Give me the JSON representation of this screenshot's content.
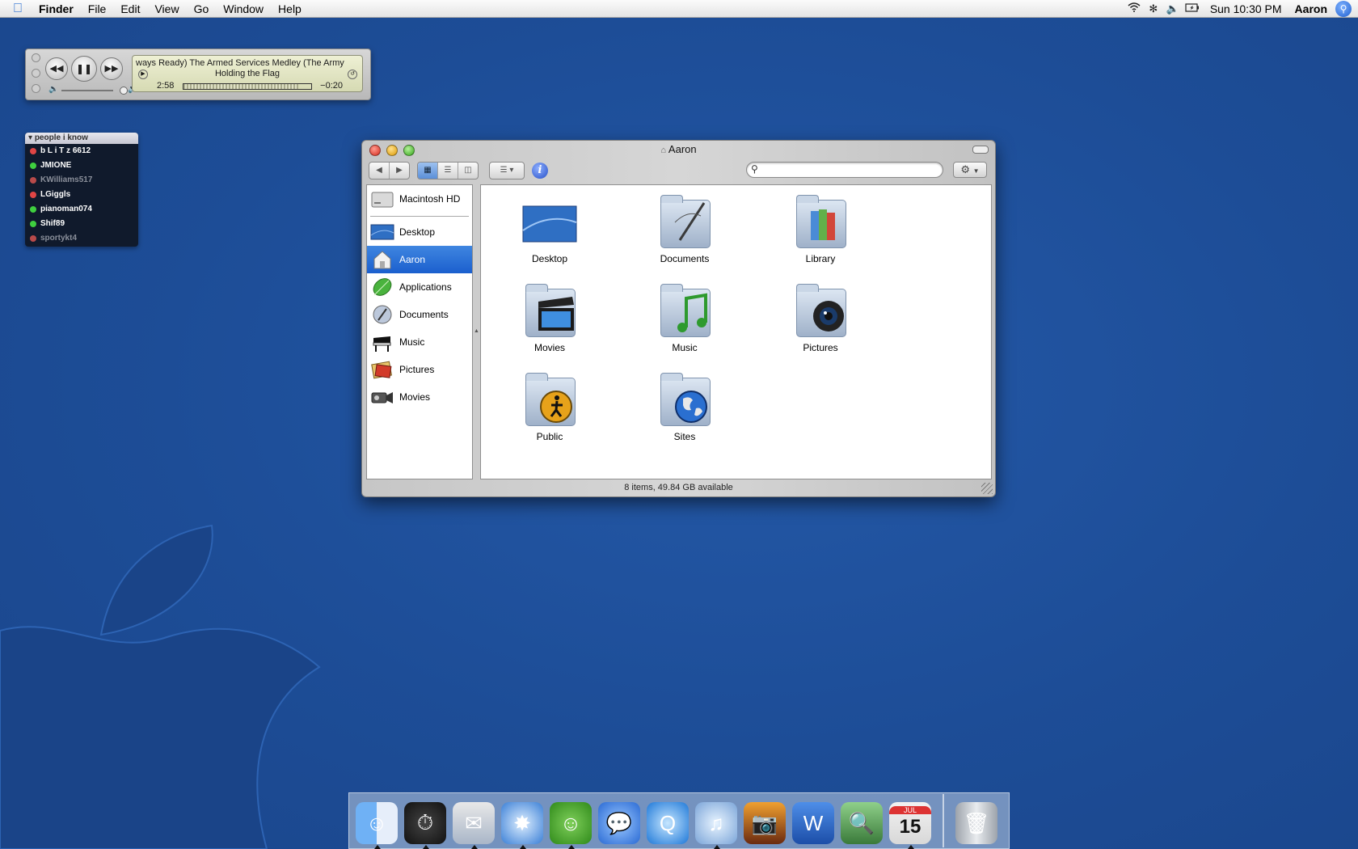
{
  "menubar": {
    "app_name": "Finder",
    "menus": [
      "File",
      "Edit",
      "View",
      "Go",
      "Window",
      "Help"
    ],
    "clock": "Sun 10:30 PM",
    "user": "Aaron"
  },
  "itunes": {
    "scroll_text": "ways Ready)    The Armed Services Medley (The Army",
    "line2": "Holding the Flag",
    "elapsed": "2:58",
    "remaining": "−0:20",
    "progress": 0.9
  },
  "buddy_list": {
    "group": "people i know",
    "buddies": [
      {
        "name": "b L i T z 6612",
        "status": "away"
      },
      {
        "name": "JMIONE",
        "status": "online"
      },
      {
        "name": "KWilliams517",
        "status": "idle"
      },
      {
        "name": "LGiggls",
        "status": "away"
      },
      {
        "name": "pianoman074",
        "status": "online"
      },
      {
        "name": "Shif89",
        "status": "online"
      },
      {
        "name": "sportykt4",
        "status": "idle"
      }
    ]
  },
  "finder": {
    "title": "Aaron",
    "search": {
      "value": "",
      "placeholder": ""
    },
    "sidebar": {
      "devices": [
        {
          "label": "Macintosh HD",
          "icon": "hard-drive-icon"
        }
      ],
      "places": [
        {
          "label": "Desktop",
          "icon": "desktop-icon",
          "selected": false
        },
        {
          "label": "Aaron",
          "icon": "home-icon",
          "selected": true
        },
        {
          "label": "Applications",
          "icon": "applications-icon",
          "selected": false
        },
        {
          "label": "Documents",
          "icon": "documents-icon",
          "selected": false
        },
        {
          "label": "Music",
          "icon": "piano-icon",
          "selected": false
        },
        {
          "label": "Pictures",
          "icon": "pictures-icon",
          "selected": false
        },
        {
          "label": "Movies",
          "icon": "camcorder-icon",
          "selected": false
        }
      ]
    },
    "items": [
      {
        "label": "Desktop",
        "icon": "desktop-folder-icon"
      },
      {
        "label": "Documents",
        "icon": "documents-folder-icon"
      },
      {
        "label": "Library",
        "icon": "library-folder-icon"
      },
      {
        "label": "Movies",
        "icon": "movies-folder-icon"
      },
      {
        "label": "Music",
        "icon": "music-folder-icon"
      },
      {
        "label": "Pictures",
        "icon": "pictures-folder-icon"
      },
      {
        "label": "Public",
        "icon": "public-folder-icon"
      },
      {
        "label": "Sites",
        "icon": "sites-folder-icon"
      }
    ],
    "status": "8 items, 49.84 GB available"
  },
  "dock": {
    "apps": [
      "Finder",
      "Dashboard",
      "Mail",
      "Safari",
      "Adium",
      "iChat",
      "QuickTime Player",
      "iTunes",
      "iPhoto",
      "Microsoft Word",
      "Preview",
      "iCal",
      "Trash"
    ],
    "ical_month": "JUL",
    "ical_day": "15"
  },
  "colors": {
    "desktop": "#1d4d97",
    "selection": "#1b5fce",
    "online": "#3fcf3f",
    "away": "#e04545"
  }
}
